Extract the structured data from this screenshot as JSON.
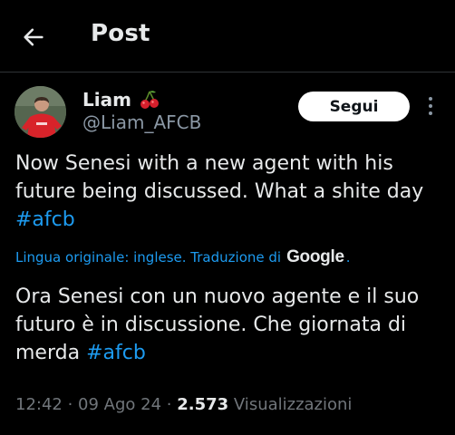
{
  "header": {
    "title": "Post"
  },
  "author": {
    "display_name": "Liam",
    "handle": "@Liam_AFCB",
    "follow_label": "Segui"
  },
  "tweet": {
    "text_plain": "Now Senesi with a new agent with his future being discussed. What a shite day ",
    "hashtag": "#afcb"
  },
  "translation": {
    "notice": "Lingua originale: inglese. Traduzione di",
    "provider": "Google",
    "dot": ".",
    "text_plain": "Ora Senesi con un nuovo agente e il suo futuro è in discussione. Che giornata di merda ",
    "hashtag": "#afcb"
  },
  "meta": {
    "time": "12:42",
    "sep1": " · ",
    "date": "09 Ago 24",
    "sep2": " · ",
    "views_count": "2.573",
    "views_label": " Visualizzazioni"
  },
  "colors": {
    "background": "#000000",
    "text": "#e7e9ea",
    "secondary": "#71767b",
    "link": "#1d9bf0",
    "divider": "#2f3336"
  },
  "icons": {
    "back": "arrow-left-icon",
    "emoji": "cherries-emoji",
    "more": "more-dots-icon"
  }
}
